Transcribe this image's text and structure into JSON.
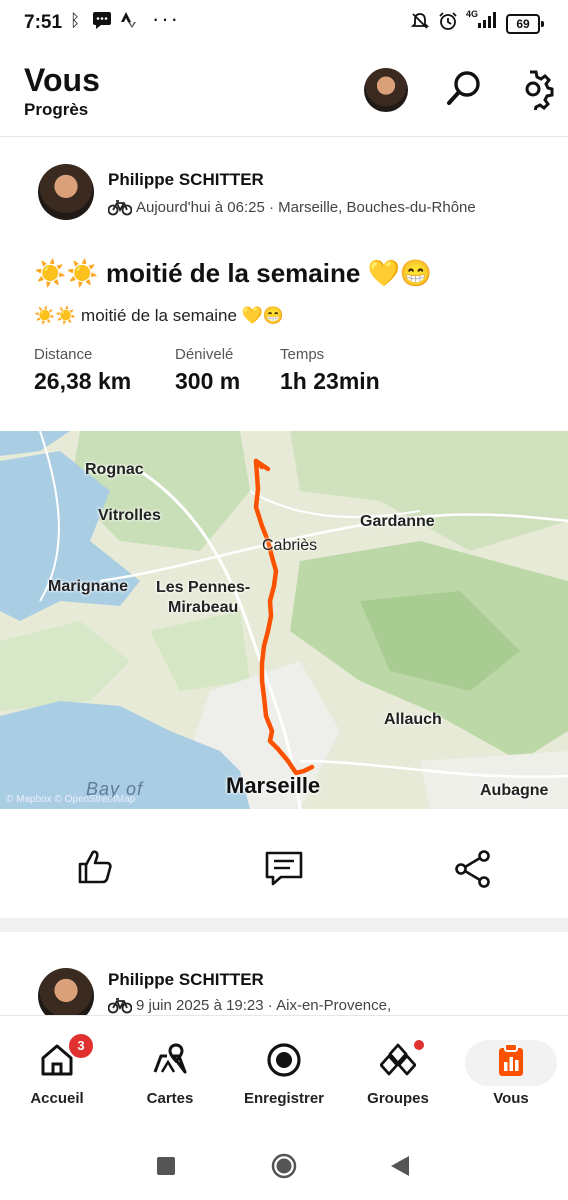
{
  "status_bar": {
    "time": "7:51",
    "battery": "69",
    "network": "4G"
  },
  "header": {
    "title": "Vous",
    "subtitle": "Progrès"
  },
  "post1": {
    "author": "Philippe SCHITTER",
    "meta": "Aujourd'hui à 06:25 · Marseille, Bouches-du-Rhône",
    "title": "☀️☀️ moitié de la semaine 💛😁",
    "description": "☀️☀️ moitié de la semaine 💛😁",
    "stats": [
      {
        "label": "Distance",
        "value": "26,38 km"
      },
      {
        "label": "Dénivelé",
        "value": "300 m"
      },
      {
        "label": "Temps",
        "value": "1h 23min"
      }
    ],
    "map": {
      "places": [
        "Rognac",
        "Vitrolles",
        "Gardanne",
        "Cabriès",
        "Marignane",
        "Les Pennes-",
        "Mirabeau",
        "Allauch",
        "Marseille",
        "Aubagne",
        "Bay of"
      ],
      "attribution": "© Mapbox © OpenStreetMap",
      "route_color": "#fc5200"
    }
  },
  "post2": {
    "author": "Philippe SCHITTER",
    "meta": "9 juin 2025 à 19:23 · Aix-en-Provence,"
  },
  "actions": {
    "like": "thumbs-up-icon",
    "comment": "comment-icon",
    "share": "share-icon"
  },
  "nav": {
    "items": [
      {
        "label": "Accueil",
        "badge": "3"
      },
      {
        "label": "Cartes"
      },
      {
        "label": "Enregistrer"
      },
      {
        "label": "Groupes"
      },
      {
        "label": "Vous"
      }
    ],
    "accent": "#fc5200"
  }
}
